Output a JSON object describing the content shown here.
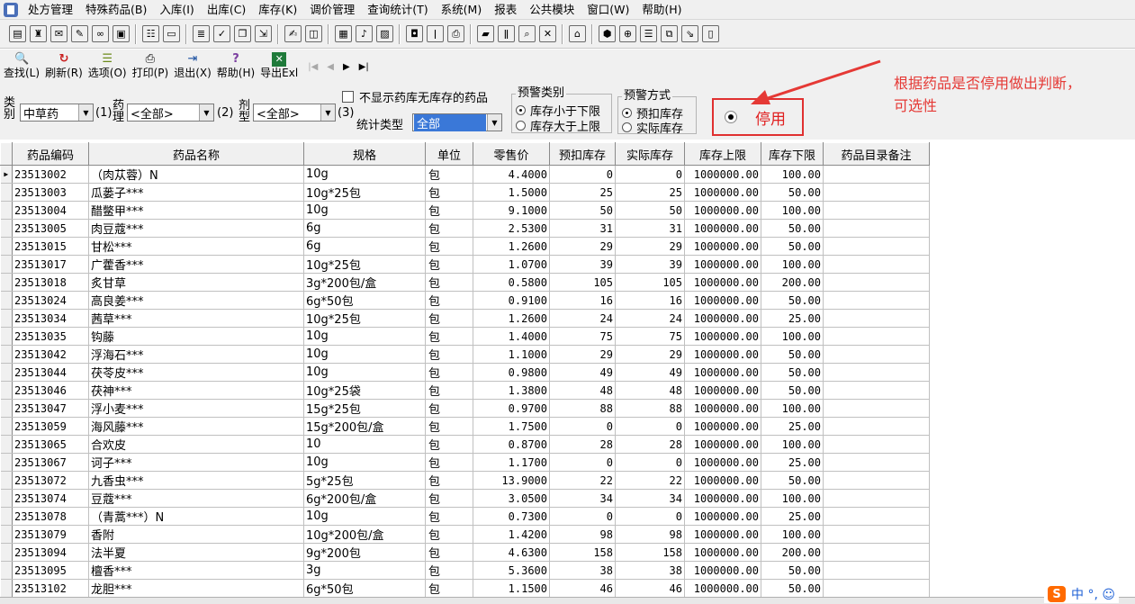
{
  "menubar": {
    "items": [
      "处方管理",
      "特殊药品(B)",
      "入库(I)",
      "出库(C)",
      "库存(K)",
      "调价管理",
      "查询统计(T)",
      "系统(M)",
      "报表",
      "公共模块",
      "窗口(W)",
      "帮助(H)"
    ]
  },
  "iconbar": {
    "groups": [
      [
        "report-icon",
        "bottle-icon",
        "mail-icon",
        "doc-edit-icon",
        "binoculars-icon",
        "stamp-icon"
      ],
      [
        "form-icon",
        "card-icon"
      ],
      [
        "list-icon",
        "check-icon",
        "copy-icon",
        "export-icon"
      ],
      [
        "edit-icon",
        "window-icon"
      ],
      [
        "grid-icon",
        "bell-icon",
        "image-icon"
      ],
      [
        "jar-icon",
        "flashlight-icon",
        "print-icon"
      ],
      [
        "truck-icon",
        "thermometer-icon",
        "magnifier-icon",
        "excel-icon"
      ],
      [
        "folder-icon"
      ],
      [
        "shield-icon",
        "zoom-icon",
        "table-icon",
        "layers-icon",
        "doc-arrow-icon",
        "clipboard-icon"
      ]
    ]
  },
  "actionbar": {
    "buttons": [
      {
        "label": "查找(L)",
        "icon": "search-icon",
        "glyph": "🔍"
      },
      {
        "label": "刷新(R)",
        "icon": "refresh-icon",
        "glyph": "↻"
      },
      {
        "label": "选项(O)",
        "icon": "options-icon",
        "glyph": "☰"
      },
      {
        "label": "打印(P)",
        "icon": "print-icon",
        "glyph": "⎙"
      },
      {
        "label": "退出(X)",
        "icon": "exit-icon",
        "glyph": "⇥"
      },
      {
        "label": "帮助(H)",
        "icon": "help-icon",
        "glyph": "?"
      },
      {
        "label": "导出Exl",
        "icon": "excel-icon",
        "glyph": "✕"
      }
    ]
  },
  "filters": {
    "category_label": "类别",
    "category_value": "中草药",
    "num1": "(1)",
    "drug_label": "药理",
    "drug_value": "<全部>",
    "num2": "(2)",
    "form_label": "剂型",
    "form_value": "<全部>",
    "num3": "(3)",
    "hide_no_stock_label": "不显示药库无库存的药品",
    "stat_type_label": "统计类型",
    "stat_type_value": "全部",
    "warn_category_title": "预警类别",
    "warn_category_options": [
      "库存小于下限",
      "库存大于上限"
    ],
    "warn_mode_title": "预警方式",
    "warn_mode_options": [
      "预扣库存",
      "实际库存"
    ],
    "stop_label": "停用"
  },
  "annotation": {
    "text_line1": "根据药品是否停用做出判断，",
    "text_line2": "可选性",
    "color": "#e53935"
  },
  "grid": {
    "columns": [
      "药品编码",
      "药品名称",
      "规格",
      "单位",
      "零售价",
      "预扣库存",
      "实际库存",
      "库存上限",
      "库存下限",
      "药品目录备注"
    ],
    "rows": [
      [
        "23513002",
        "（肉苁蓉）N",
        "10g",
        "包",
        "4.4000",
        "0",
        "0",
        "1000000.00",
        "100.00",
        ""
      ],
      [
        "23513003",
        "瓜蒌子***",
        "10g*25包",
        "包",
        "1.5000",
        "25",
        "25",
        "1000000.00",
        "50.00",
        ""
      ],
      [
        "23513004",
        "醋鳖甲***",
        "10g",
        "包",
        "9.1000",
        "50",
        "50",
        "1000000.00",
        "100.00",
        ""
      ],
      [
        "23513005",
        "肉豆蔻***",
        "6g",
        "包",
        "2.5300",
        "31",
        "31",
        "1000000.00",
        "50.00",
        ""
      ],
      [
        "23513015",
        "甘松***",
        "6g",
        "包",
        "1.2600",
        "29",
        "29",
        "1000000.00",
        "50.00",
        ""
      ],
      [
        "23513017",
        "广藿香***",
        "10g*25包",
        "包",
        "1.0700",
        "39",
        "39",
        "1000000.00",
        "100.00",
        ""
      ],
      [
        "23513018",
        "炙甘草",
        "3g*200包/盒",
        "包",
        "0.5800",
        "105",
        "105",
        "1000000.00",
        "200.00",
        ""
      ],
      [
        "23513024",
        "高良姜***",
        "6g*50包",
        "包",
        "0.9100",
        "16",
        "16",
        "1000000.00",
        "50.00",
        ""
      ],
      [
        "23513034",
        "茜草***",
        "10g*25包",
        "包",
        "1.2600",
        "24",
        "24",
        "1000000.00",
        "25.00",
        ""
      ],
      [
        "23513035",
        "钩藤",
        "10g",
        "包",
        "1.4000",
        "75",
        "75",
        "1000000.00",
        "100.00",
        ""
      ],
      [
        "23513042",
        "浮海石***",
        "10g",
        "包",
        "1.1000",
        "29",
        "29",
        "1000000.00",
        "50.00",
        ""
      ],
      [
        "23513044",
        "茯苓皮***",
        "10g",
        "包",
        "0.9800",
        "49",
        "49",
        "1000000.00",
        "50.00",
        ""
      ],
      [
        "23513046",
        "茯神***",
        "10g*25袋",
        "包",
        "1.3800",
        "48",
        "48",
        "1000000.00",
        "50.00",
        ""
      ],
      [
        "23513047",
        "浮小麦***",
        "15g*25包",
        "包",
        "0.9700",
        "88",
        "88",
        "1000000.00",
        "100.00",
        ""
      ],
      [
        "23513059",
        "海风藤***",
        "15g*200包/盒",
        "包",
        "1.7500",
        "0",
        "0",
        "1000000.00",
        "25.00",
        ""
      ],
      [
        "23513065",
        "合欢皮",
        "10",
        "包",
        "0.8700",
        "28",
        "28",
        "1000000.00",
        "100.00",
        ""
      ],
      [
        "23513067",
        "诃子***",
        "10g",
        "包",
        "1.1700",
        "0",
        "0",
        "1000000.00",
        "25.00",
        ""
      ],
      [
        "23513072",
        "九香虫***",
        "5g*25包",
        "包",
        "13.9000",
        "22",
        "22",
        "1000000.00",
        "50.00",
        ""
      ],
      [
        "23513074",
        "豆蔻***",
        "6g*200包/盒",
        "包",
        "3.0500",
        "34",
        "34",
        "1000000.00",
        "100.00",
        ""
      ],
      [
        "23513078",
        "（青蒿***）N",
        "10g",
        "包",
        "0.7300",
        "0",
        "0",
        "1000000.00",
        "25.00",
        ""
      ],
      [
        "23513079",
        "香附",
        "10g*200包/盒",
        "包",
        "1.4200",
        "98",
        "98",
        "1000000.00",
        "100.00",
        ""
      ],
      [
        "23513094",
        "法半夏",
        "9g*200包",
        "包",
        "4.6300",
        "158",
        "158",
        "1000000.00",
        "200.00",
        ""
      ],
      [
        "23513095",
        "檀香***",
        "3g",
        "包",
        "5.3600",
        "38",
        "38",
        "1000000.00",
        "50.00",
        ""
      ],
      [
        "23513102",
        "龙胆***",
        "6g*50包",
        "包",
        "1.1500",
        "46",
        "46",
        "1000000.00",
        "50.00",
        ""
      ]
    ]
  },
  "ime": {
    "logo": "S",
    "text": "中 °, ☺"
  }
}
